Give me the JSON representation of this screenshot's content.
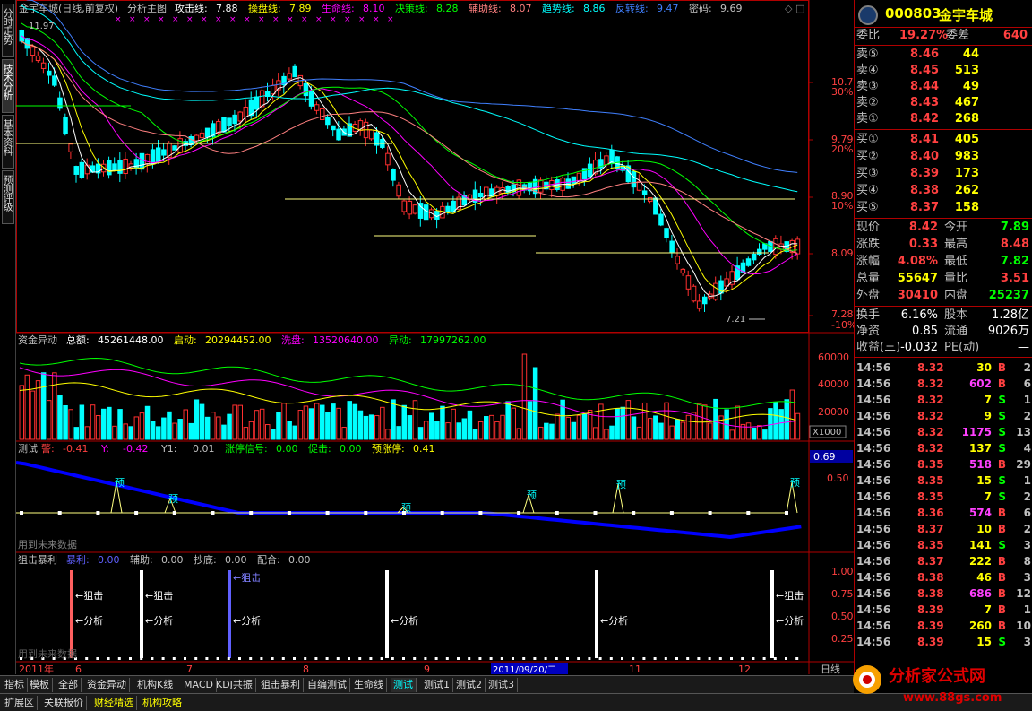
{
  "left_tabs": [
    "分时走势",
    "技术分析",
    "基本资料",
    "预测评级"
  ],
  "main_panel": {
    "title": "金宇车城(日线,前复权)",
    "template": "分析主图",
    "indicators": [
      {
        "label": "攻击线:",
        "value": "7.88",
        "color": "#ffffff"
      },
      {
        "label": "操盘线:",
        "value": "7.89",
        "color": "#ffff00"
      },
      {
        "label": "生命线:",
        "value": "8.10",
        "color": "#ff00ff"
      },
      {
        "label": "决策线:",
        "value": "8.28",
        "color": "#00ff00"
      },
      {
        "label": "辅助线:",
        "value": "8.07",
        "color": "#ff8080"
      },
      {
        "label": "趋势线:",
        "value": "8.86",
        "color": "#00ffff"
      },
      {
        "label": "反转线:",
        "value": "9.47",
        "color": "#4080ff"
      },
      {
        "label": "密码:",
        "value": "9.69",
        "color": "#c0c0c0"
      }
    ],
    "high_marker": "11.97",
    "low_marker": "7.21",
    "y_prices": [
      "10.77",
      "9.79",
      "8.90",
      "8.09",
      "7.28"
    ],
    "y_pcts": [
      "30%",
      "20%",
      "10%",
      "",
      "-10%"
    ]
  },
  "volume_panel": {
    "title": "资金异动",
    "stats": [
      {
        "label": "总额:",
        "value": "45261448.00",
        "color": "#ffffff"
      },
      {
        "label": "启动:",
        "value": "20294452.00",
        "color": "#ffff00"
      },
      {
        "label": "洗盘:",
        "value": "13520640.00",
        "color": "#ff00ff"
      },
      {
        "label": "异动:",
        "value": "17997262.00",
        "color": "#00ff00"
      }
    ],
    "y_labels": [
      "60000",
      "40000",
      "20000"
    ],
    "unit": "X1000"
  },
  "test_panel": {
    "title": "测试",
    "stats": [
      {
        "label": "警:",
        "value": "-0.41",
        "color": "#ff4040"
      },
      {
        "label": "Y:",
        "value": "-0.42",
        "color": "#ff00ff"
      },
      {
        "label": "Y1:",
        "value": "0.01",
        "color": "#c0c0c0"
      },
      {
        "label": "涨停信号:",
        "value": "0.00",
        "color": "#00ff00"
      },
      {
        "label": "促击:",
        "value": "0.00",
        "color": "#00ff00"
      },
      {
        "label": "预涨停:",
        "value": "0.41",
        "color": "#ffff00"
      }
    ],
    "current": "0.69",
    "y_label": "0.50",
    "marker": "预",
    "footnote": "用到未来数据"
  },
  "snipe_panel": {
    "title": "狙击暴利",
    "stats": [
      {
        "label": "暴利:",
        "value": "0.00",
        "color": "#6060ff"
      },
      {
        "label": "辅助:",
        "value": "0.00",
        "color": "#c0c0c0"
      },
      {
        "label": "抄底:",
        "value": "0.00",
        "color": "#c0c0c0"
      },
      {
        "label": "配合:",
        "value": "0.00",
        "color": "#c0c0c0"
      }
    ],
    "y_labels": [
      "1.00",
      "0.75",
      "0.50",
      "0.25"
    ],
    "snipe_label": "←狙击",
    "analyze_label": "←分析",
    "footnote": "用到未来数据"
  },
  "date_axis": {
    "labels": [
      "2011年",
      "6",
      "7",
      "8",
      "9",
      "10",
      "11",
      "12"
    ],
    "selected": "2011/09/20/二",
    "period": "日线"
  },
  "quote": {
    "code": "000803",
    "name": "金宇车城",
    "webi_label": "委比",
    "webi_value": "19.27%",
    "weicha_label": "委差",
    "weicha_value": "640",
    "asks": [
      {
        "label": "卖⑤",
        "price": "8.46",
        "vol": "44"
      },
      {
        "label": "卖④",
        "price": "8.45",
        "vol": "513"
      },
      {
        "label": "卖③",
        "price": "8.44",
        "vol": "49"
      },
      {
        "label": "卖②",
        "price": "8.43",
        "vol": "467"
      },
      {
        "label": "卖①",
        "price": "8.42",
        "vol": "268"
      }
    ],
    "bids": [
      {
        "label": "买①",
        "price": "8.41",
        "vol": "405"
      },
      {
        "label": "买②",
        "price": "8.40",
        "vol": "983"
      },
      {
        "label": "买③",
        "price": "8.39",
        "vol": "173"
      },
      {
        "label": "买④",
        "price": "8.38",
        "vol": "262"
      },
      {
        "label": "买⑤",
        "price": "8.37",
        "vol": "158"
      }
    ],
    "stats": [
      {
        "l1": "现价",
        "v1": "8.42",
        "c1": "#ff4040",
        "l2": "今开",
        "v2": "7.89",
        "c2": "#00ff00"
      },
      {
        "l1": "涨跌",
        "v1": "0.33",
        "c1": "#ff4040",
        "l2": "最高",
        "v2": "8.48",
        "c2": "#ff4040"
      },
      {
        "l1": "涨幅",
        "v1": "4.08%",
        "c1": "#ff4040",
        "l2": "最低",
        "v2": "7.82",
        "c2": "#00ff00"
      },
      {
        "l1": "总量",
        "v1": "55647",
        "c1": "#ffff00",
        "l2": "量比",
        "v2": "3.51",
        "c2": "#ff4040"
      },
      {
        "l1": "外盘",
        "v1": "30410",
        "c1": "#ff4040",
        "l2": "内盘",
        "v2": "25237",
        "c2": "#00ff00"
      }
    ],
    "stats2": [
      {
        "l1": "换手",
        "v1": "6.16%",
        "c1": "#ffffff",
        "l2": "股本",
        "v2": "1.28亿",
        "c2": "#ffffff"
      },
      {
        "l1": "净资",
        "v1": "0.85",
        "c1": "#ffffff",
        "l2": "流通",
        "v2": "9026万",
        "c2": "#ffffff"
      },
      {
        "l1": "收益(三)",
        "v1": "-0.032",
        "c1": "#ffffff",
        "l2": "PE(动)",
        "v2": "—",
        "c2": "#ffffff"
      }
    ],
    "ticks": [
      {
        "t": "14:56",
        "p": "8.32",
        "v": "30",
        "s": "B",
        "n": "2"
      },
      {
        "t": "14:56",
        "p": "8.32",
        "v": "602",
        "s": "B",
        "n": "6"
      },
      {
        "t": "14:56",
        "p": "8.32",
        "v": "7",
        "s": "S",
        "n": "1"
      },
      {
        "t": "14:56",
        "p": "8.32",
        "v": "9",
        "s": "S",
        "n": "2"
      },
      {
        "t": "14:56",
        "p": "8.32",
        "v": "1175",
        "s": "S",
        "n": "13"
      },
      {
        "t": "14:56",
        "p": "8.32",
        "v": "137",
        "s": "S",
        "n": "4"
      },
      {
        "t": "14:56",
        "p": "8.35",
        "v": "518",
        "s": "B",
        "n": "29"
      },
      {
        "t": "14:56",
        "p": "8.35",
        "v": "15",
        "s": "S",
        "n": "1"
      },
      {
        "t": "14:56",
        "p": "8.35",
        "v": "7",
        "s": "S",
        "n": "2"
      },
      {
        "t": "14:56",
        "p": "8.36",
        "v": "574",
        "s": "B",
        "n": "6"
      },
      {
        "t": "14:56",
        "p": "8.37",
        "v": "10",
        "s": "B",
        "n": "2"
      },
      {
        "t": "14:56",
        "p": "8.35",
        "v": "141",
        "s": "S",
        "n": "3"
      },
      {
        "t": "14:56",
        "p": "8.37",
        "v": "222",
        "s": "B",
        "n": "8"
      },
      {
        "t": "14:56",
        "p": "8.38",
        "v": "46",
        "s": "B",
        "n": "3"
      },
      {
        "t": "14:56",
        "p": "8.38",
        "v": "686",
        "s": "B",
        "n": "12"
      },
      {
        "t": "14:56",
        "p": "8.39",
        "v": "7",
        "s": "B",
        "n": "1"
      },
      {
        "t": "14:56",
        "p": "8.39",
        "v": "260",
        "s": "B",
        "n": "10"
      },
      {
        "t": "14:56",
        "p": "8.39",
        "v": "15",
        "s": "S",
        "n": "3"
      }
    ]
  },
  "bottom_tabs": [
    "指标",
    "模板",
    "全部",
    "资金异动",
    "机构K线",
    "MACD",
    "KDJ共振",
    "狙击暴利",
    "自编测试",
    "生命线",
    "测试",
    "测试1",
    "测试2",
    "测试3"
  ],
  "bottom_tabs2": [
    "扩展区",
    "关联报价",
    "财经精选",
    "机构攻略"
  ],
  "logo": {
    "brand": "分析家公式网",
    "url": "www.88gs.com"
  }
}
